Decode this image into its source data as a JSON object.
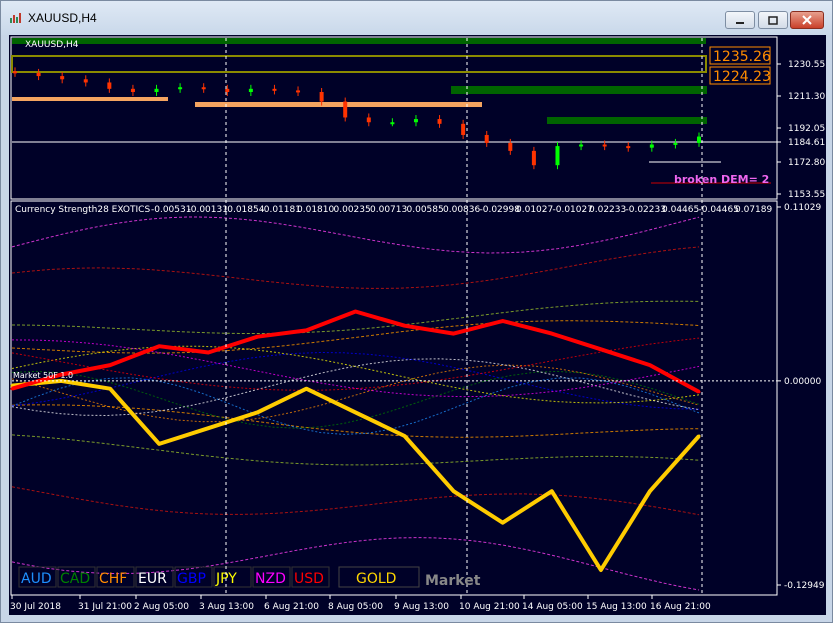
{
  "window": {
    "title": "XAUUSD,H4",
    "controls": [
      "minimize",
      "maximize",
      "close"
    ]
  },
  "main_pane": {
    "symbol_label": "XAUUSD,H4",
    "price_ticks": [
      "1230.55",
      "1211.30",
      "1192.05",
      "1184.61",
      "1172.80",
      "1153.55"
    ],
    "current_price": "1184.61",
    "level_boxes": [
      "1235.26",
      "1224.23"
    ],
    "annotation": "broken DEM= 2"
  },
  "indicator_pane": {
    "header": "Currency Strength28 EXOTICS",
    "header_values": [
      "-0.00531",
      "-0.00131",
      "-0.01854",
      "-0.01181",
      "0.01810",
      "0.00235",
      "0.00713",
      "0.00585",
      "0.00836",
      "-0.02998",
      "0.01027",
      "-0.01027",
      "0.02233",
      "-0.02233",
      "0.04465",
      "-0.04465",
      "0.07189"
    ],
    "y_ticks": [
      "0.11029",
      "0.00000",
      "-0.12949"
    ],
    "corner_label": "Market 50F 1.0",
    "currency_legend": [
      {
        "name": "AUD",
        "color": "#1e90ff"
      },
      {
        "name": "CAD",
        "color": "#008000"
      },
      {
        "name": "CHF",
        "color": "#ff8c00"
      },
      {
        "name": "EUR",
        "color": "#ffffff"
      },
      {
        "name": "GBP",
        "color": "#0000ff"
      },
      {
        "name": "JPY",
        "color": "#ffff00"
      },
      {
        "name": "NZD",
        "color": "#ff00ff"
      },
      {
        "name": "USD",
        "color": "#ff0000"
      },
      {
        "name": "GOLD",
        "color": "#ffd700"
      }
    ],
    "market_label": "Market"
  },
  "time_axis": [
    "30 Jul 2018",
    "31 Jul 21:00",
    "2 Aug 05:00",
    "3 Aug 13:00",
    "6 Aug 21:00",
    "8 Aug 05:00",
    "9 Aug 13:00",
    "10 Aug 21:00",
    "14 Aug 05:00",
    "15 Aug 13:00",
    "16 Aug 21:00"
  ],
  "colors": {
    "background": "#000128",
    "bull_candle": "#00ff00",
    "bear_candle": "#ff3300",
    "gold_line": "#ffcc00",
    "usd_line": "#ff0000",
    "supply_zone": "#006400",
    "demand_zone": "#f4a460"
  },
  "chart_data": {
    "type": "line",
    "x": [
      "30 Jul 2018",
      "31 Jul 21:00",
      "2 Aug 05:00",
      "3 Aug 13:00",
      "6 Aug 21:00",
      "8 Aug 05:00",
      "9 Aug 13:00",
      "10 Aug 21:00",
      "14 Aug 05:00",
      "15 Aug 13:00",
      "16 Aug 21:00"
    ],
    "price_range": [
      1150,
      1240
    ],
    "candles_close": [
      1224,
      1222,
      1220,
      1218,
      1214,
      1212,
      1214,
      1215,
      1214,
      1212,
      1214,
      1213,
      1212,
      1206,
      1196,
      1193,
      1193,
      1195,
      1192,
      1185,
      1180,
      1175,
      1166,
      1178,
      1179,
      1178,
      1177,
      1179,
      1180,
      1184
    ],
    "strength_range": [
      -0.12949,
      0.11029
    ],
    "series": [
      {
        "name": "GOLD",
        "values": [
          -0.003,
          0.0,
          -0.005,
          -0.04,
          -0.03,
          -0.02,
          -0.005,
          -0.02,
          -0.035,
          -0.07,
          -0.09,
          -0.07,
          -0.12,
          -0.07,
          -0.035
        ]
      },
      {
        "name": "USD",
        "values": [
          -0.005,
          0.004,
          0.01,
          0.022,
          0.018,
          0.028,
          0.032,
          0.044,
          0.035,
          0.03,
          0.038,
          0.03,
          0.02,
          0.01,
          -0.007
        ]
      }
    ]
  }
}
